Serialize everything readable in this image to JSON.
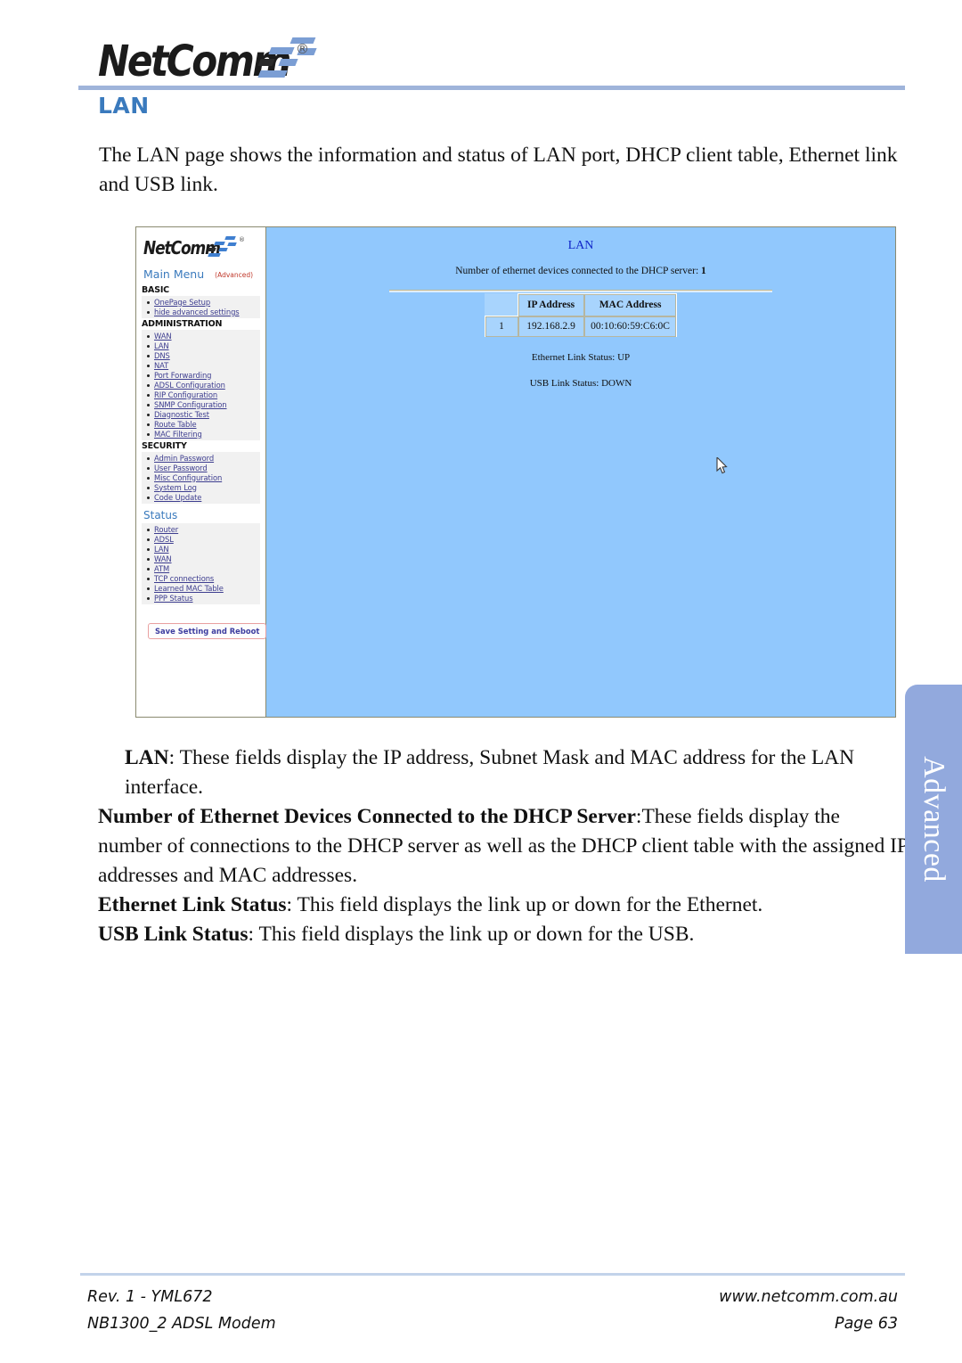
{
  "header": {
    "logo_text": "NetComm",
    "registered_mark": "®"
  },
  "section_title": "LAN",
  "intro_paragraph": "The LAN page shows the information and status of LAN port, DHCP client table, Ethernet link and USB link.",
  "screenshot": {
    "sidebar": {
      "logo_text": "NetComm",
      "registered_mark": "®",
      "main_menu_label": "Main Menu",
      "advanced_label": "(Advanced)",
      "basic_heading": "BASIC",
      "basic_items": [
        "OnePage Setup",
        "hide advanced settings"
      ],
      "administration_heading": "ADMINISTRATION",
      "administration_items": [
        "WAN",
        "LAN",
        "DNS",
        "NAT",
        "Port Forwarding",
        "ADSL Configuration",
        "RIP Configuration",
        "SNMP Configuration",
        "Diagnostic Test",
        "Route Table",
        "MAC Filtering"
      ],
      "security_heading": "SECURITY",
      "security_items": [
        "Admin Password",
        "User Password",
        "Misc Configuration",
        "System Log",
        "Code Update"
      ],
      "status_heading": "Status",
      "status_items": [
        "Router",
        "ADSL",
        "LAN",
        "WAN",
        "ATM",
        "TCP connections",
        "Learned MAC Table",
        "PPP Status"
      ],
      "save_button_label": "Save Setting and Reboot"
    },
    "content": {
      "title": "LAN",
      "dhcp_count_text": "Number of ethernet devices connected to the DHCP server: ",
      "dhcp_count_value": "1",
      "table": {
        "columns": [
          "",
          "IP Address",
          "MAC Address"
        ],
        "rows": [
          [
            "1",
            "192.168.2.9",
            "00:10:60:59:C6:0C"
          ]
        ]
      },
      "ethernet_link_status": "Ethernet Link Status: UP",
      "usb_link_status": "USB Link Status: DOWN"
    }
  },
  "descriptions": {
    "lan_term": "LAN",
    "lan_text": ":  These fields display the IP address, Subnet Mask and MAC address for the LAN interface.",
    "dhcp_term": "Number of Ethernet Devices Connected to the DHCP Server",
    "dhcp_text": ":These fields display the number of connections to the DHCP server as well as the DHCP client table with the assigned IP addresses and MAC addresses.",
    "ethernet_term": "Ethernet Link Status",
    "ethernet_text": ":  This field displays the link up or down for the Ethernet.",
    "usb_term": "USB Link Status",
    "usb_text": ":  This field displays the link up or down for the USB."
  },
  "side_tab": {
    "label": "Advanced"
  },
  "footer": {
    "revision": "Rev. 1 - YML672",
    "website": "www.netcomm.com.au",
    "product": "NB1300_2  ADSL Modem",
    "page": "Page 63"
  },
  "colors": {
    "accent_blue": "#3a7abd",
    "screenshot_bg": "#91c8fd",
    "side_tab": "#92a9dd",
    "header_rule": "#9fb4da",
    "link": "#3d3d8f"
  }
}
